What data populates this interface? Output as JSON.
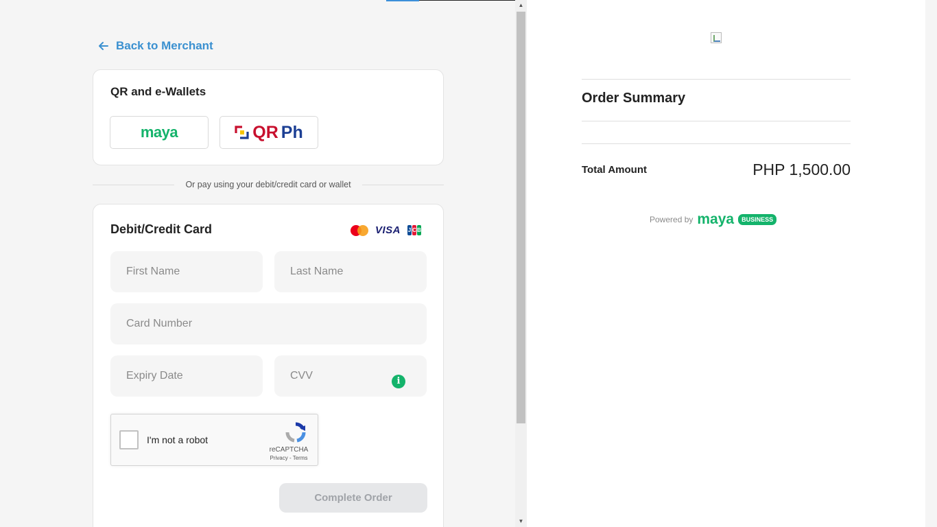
{
  "back": {
    "label": "Back to Merchant"
  },
  "wallets": {
    "title": "QR and e-Wallets",
    "options": [
      {
        "logo_text": "maya"
      },
      {
        "logo_text_qr": "QR",
        "logo_text_ph": "Ph"
      }
    ]
  },
  "divider": {
    "text": "Or pay using your debit/credit card or wallet"
  },
  "card_form": {
    "title": "Debit/Credit Card",
    "brands": [
      "mastercard-icon",
      "visa-icon",
      "jcb-icon"
    ],
    "visa_text": "VISA",
    "jcb_letters": [
      "J",
      "C",
      "B"
    ],
    "fields": {
      "first_name": {
        "placeholder": "First Name",
        "value": ""
      },
      "last_name": {
        "placeholder": "Last Name",
        "value": ""
      },
      "card_number": {
        "placeholder": "Card Number",
        "value": ""
      },
      "expiry": {
        "placeholder": "Expiry Date",
        "value": ""
      },
      "cvv": {
        "placeholder": "CVV",
        "value": ""
      }
    },
    "cvv_info": "i",
    "captcha": {
      "label": "I'm not a robot",
      "brand": "reCAPTCHA",
      "terms": "Privacy - Terms"
    },
    "submit": "Complete Order"
  },
  "summary": {
    "title": "Order Summary",
    "total_label": "Total Amount",
    "total_value": "PHP 1,500.00",
    "powered_by": "Powered by",
    "powered_brand": "maya",
    "powered_badge": "BUSINESS"
  },
  "colors": {
    "accent": "#3a90d0",
    "maya_green": "#14b36b",
    "qr_red": "#c8102e",
    "qr_blue": "#1c3f94"
  }
}
